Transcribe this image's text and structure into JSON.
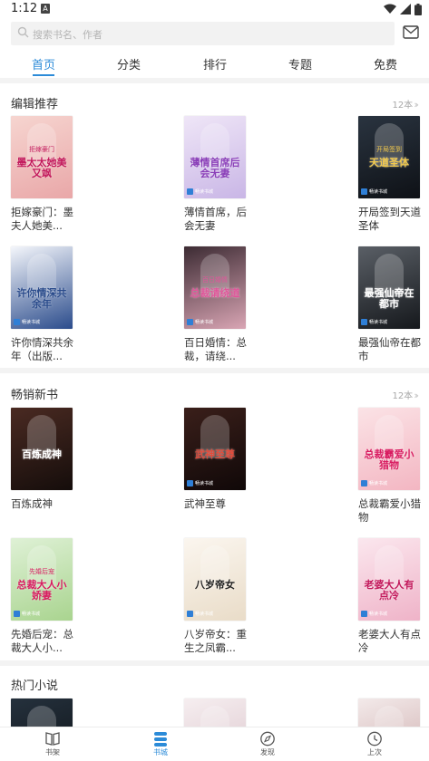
{
  "status_bar": {
    "time": "1:12",
    "notification_letter": "A"
  },
  "search": {
    "placeholder": "搜索书名、作者"
  },
  "tabs": [
    {
      "label": "首页",
      "active": true
    },
    {
      "label": "分类",
      "active": false
    },
    {
      "label": "排行",
      "active": false
    },
    {
      "label": "专题",
      "active": false
    },
    {
      "label": "免费",
      "active": false
    }
  ],
  "sections": [
    {
      "title": "编辑推荐",
      "more": "12本",
      "books": [
        {
          "title": "拒嫁豪门：墨夫人她美...",
          "cover_text": "墨太太她美又飒",
          "cover_subtext": "拒嫁豪门",
          "cover_colors": [
            "#f6d5d0",
            "#e9a7a8"
          ],
          "text_color": "#c2185b",
          "badge": ""
        },
        {
          "title": "薄情首席，后会无妻",
          "cover_text": "薄情首席后会无妻",
          "cover_subtext": "",
          "cover_colors": [
            "#efe6f7",
            "#c9b6e6"
          ],
          "text_color": "#8a3fb8",
          "badge": "畅读书城"
        },
        {
          "title": "开局签到天道圣体",
          "cover_text": "天道圣体",
          "cover_subtext": "开局签到",
          "cover_colors": [
            "#2a3440",
            "#0e1116"
          ],
          "text_color": "#f2c94c",
          "badge": "畅读书城"
        },
        {
          "title": "许你情深共余年（出版...",
          "cover_text": "许你情深共余年",
          "cover_subtext": "",
          "cover_colors": [
            "#f4f6fb",
            "#2b4c8c"
          ],
          "text_color": "#2b4c8c",
          "badge": "畅读书城"
        },
        {
          "title": "百日婚情：总裁，请绕...",
          "cover_text": "总裁请绕道",
          "cover_subtext": "百日婚情",
          "cover_colors": [
            "#3c2b33",
            "#d9a5b4"
          ],
          "text_color": "#e0559a",
          "badge": "畅读书城"
        },
        {
          "title": "最强仙帝在都市",
          "cover_text": "最强仙帝在都市",
          "cover_subtext": "",
          "cover_colors": [
            "#5a5f66",
            "#15181c"
          ],
          "text_color": "#ffffff",
          "badge": "畅读书城"
        }
      ]
    },
    {
      "title": "畅销新书",
      "more": "12本",
      "books": [
        {
          "title": "百炼成神",
          "cover_text": "百炼成神",
          "cover_subtext": "",
          "cover_colors": [
            "#4a2a22",
            "#150d0b"
          ],
          "text_color": "#ffffff",
          "badge": ""
        },
        {
          "title": "武神至尊",
          "cover_text": "武神至尊",
          "cover_subtext": "",
          "cover_colors": [
            "#3a1f1a",
            "#100808"
          ],
          "text_color": "#e24b3b",
          "badge": "畅读书城"
        },
        {
          "title": "总裁霸爱小猎物",
          "cover_text": "总裁霸爱小猎物",
          "cover_subtext": "",
          "cover_colors": [
            "#fbe3e6",
            "#f3b6c2"
          ],
          "text_color": "#d81b60",
          "badge": "畅读书城"
        },
        {
          "title": "先婚后宠：总裁大人小...",
          "cover_text": "总裁大人小娇妻",
          "cover_subtext": "先婚后宠",
          "cover_colors": [
            "#dff1d6",
            "#a9d48f"
          ],
          "text_color": "#d81b60",
          "badge": "畅读书城"
        },
        {
          "title": "八岁帝女：重生之凤霸...",
          "cover_text": "八岁帝女",
          "cover_subtext": "",
          "cover_colors": [
            "#fbf6ef",
            "#e9dcc8"
          ],
          "text_color": "#222222",
          "badge": "畅读书城"
        },
        {
          "title": "老婆大人有点冷",
          "cover_text": "老婆大人有点冷",
          "cover_subtext": "",
          "cover_colors": [
            "#fbe7ee",
            "#efb3c8"
          ],
          "text_color": "#c2185b",
          "badge": "畅读书城"
        }
      ]
    },
    {
      "title": "热门小说",
      "more": "",
      "books": [
        {
          "cover_colors": [
            "#25313d",
            "#0c1014"
          ]
        },
        {
          "cover_colors": [
            "#f6eef0",
            "#d9c2c9"
          ]
        },
        {
          "cover_colors": [
            "#f3eaea",
            "#caa7a7"
          ]
        }
      ]
    }
  ],
  "bottom_nav": [
    {
      "label": "书架",
      "icon": "book-open-icon",
      "active": false
    },
    {
      "label": "书城",
      "icon": "store-icon",
      "active": true
    },
    {
      "label": "发现",
      "icon": "compass-icon",
      "active": false
    },
    {
      "label": "上次",
      "icon": "clock-icon",
      "active": false
    }
  ],
  "colors": {
    "accent": "#2c8bd8",
    "separator": "#f3f3f3"
  }
}
